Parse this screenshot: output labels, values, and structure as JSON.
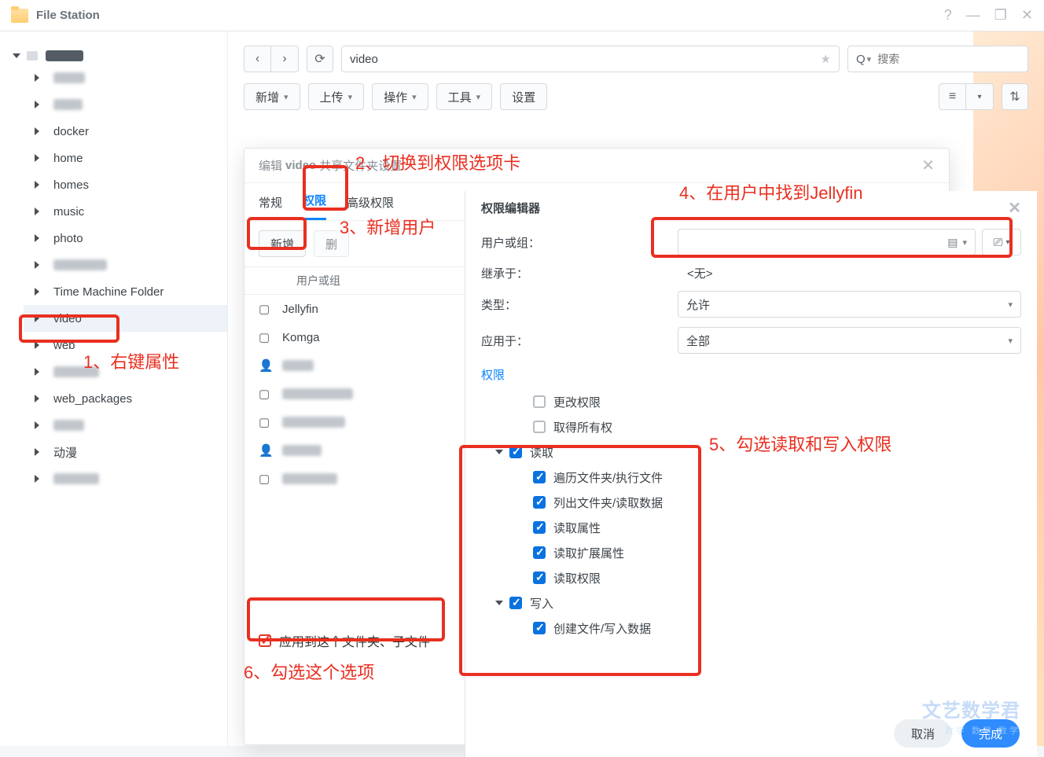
{
  "app": {
    "title": "File Station"
  },
  "nav": {
    "path": "video",
    "searchPlaceholder": "搜索"
  },
  "toolbar": {
    "new": "新增",
    "upload": "上传",
    "ops": "操作",
    "tools": "工具",
    "settings": "设置"
  },
  "sidebar": {
    "items": [
      {
        "label": ""
      },
      {
        "label": ""
      },
      {
        "label": "docker"
      },
      {
        "label": "home"
      },
      {
        "label": "homes"
      },
      {
        "label": "music"
      },
      {
        "label": "photo"
      },
      {
        "label": ""
      },
      {
        "label": "Time Machine Folder"
      },
      {
        "label": "video",
        "sel": true
      },
      {
        "label": "web"
      },
      {
        "label": ""
      },
      {
        "label": "web_packages"
      },
      {
        "label": ""
      },
      {
        "label": "动漫"
      },
      {
        "label": ""
      }
    ]
  },
  "dlg1": {
    "titlePre": "编辑",
    "titleMid": "video",
    "titlePost": "共享文件夹设置",
    "tabs": {
      "general": "常规",
      "perm": "权限",
      "adv": "高级权限"
    },
    "add": "新增",
    "del": "删",
    "col": "用户或组",
    "rows": [
      {
        "icon": "sq",
        "label": "Jellyfin"
      },
      {
        "icon": "sq",
        "label": "Komga"
      },
      {
        "icon": "usr",
        "label": "",
        "blurW": 40
      },
      {
        "icon": "sq",
        "label": "",
        "blurW": 90
      },
      {
        "icon": "sq",
        "label": "",
        "blurW": 80
      },
      {
        "icon": "usr",
        "label": "",
        "blurW": 50
      },
      {
        "icon": "sq",
        "label": "",
        "blurW": 70
      }
    ],
    "apply": "应用到这个文件夹、子文件"
  },
  "dlg2": {
    "title": "权限编辑器",
    "fUser": "用户或组：",
    "fInherit": "继承于：",
    "fType": "类型：",
    "fApply": "应用于：",
    "vInherit": "<无>",
    "vType": "允许",
    "vApply": "全部",
    "perm": "权限",
    "change": "更改权限",
    "own": "取得所有权",
    "read": "读取",
    "r1": "遍历文件夹/执行文件",
    "r2": "列出文件夹/读取数据",
    "r3": "读取属性",
    "r4": "读取扩展属性",
    "r5": "读取权限",
    "write": "写入",
    "w1": "创建文件/写入数据"
  },
  "btns": {
    "cancel": "取消",
    "done": "完成"
  },
  "ann": {
    "a1": "1、右键属性",
    "a2": "2、切换到权限选项卡",
    "a3": "3、新增用户",
    "a4": "4、在用户中找到Jellyfin",
    "a5": "5、勾选读取和写入权限",
    "a6": "6、勾选这个选项"
  },
  "wm": "文艺数学君"
}
